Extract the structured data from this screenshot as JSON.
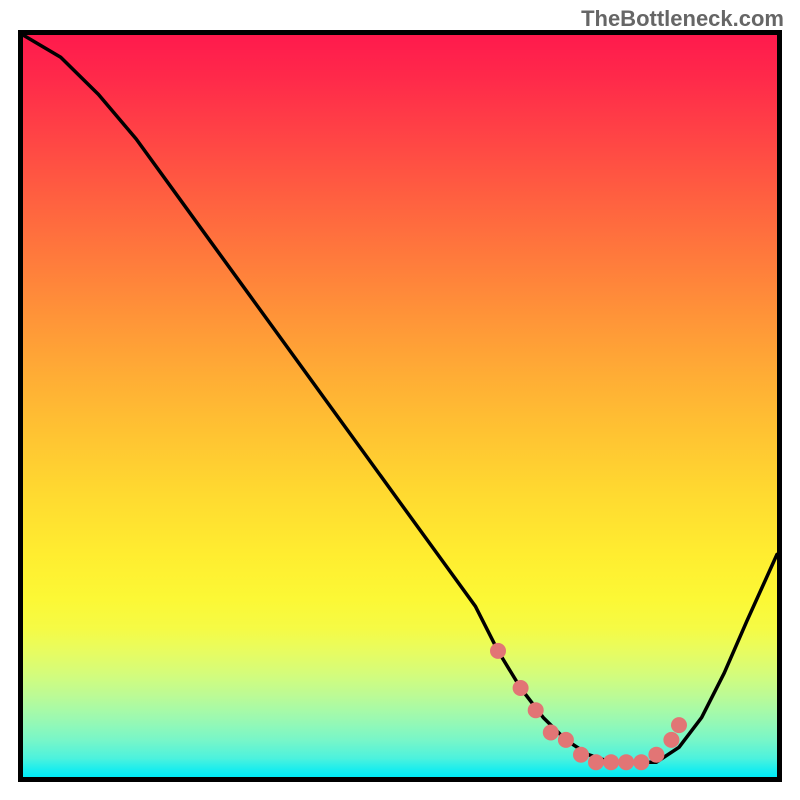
{
  "watermark": "TheBottleneck.com",
  "chart_data": {
    "type": "line",
    "title": "",
    "xlabel": "",
    "ylabel": "",
    "xlim": [
      0,
      100
    ],
    "ylim": [
      0,
      100
    ],
    "series": [
      {
        "name": "bottleneck-curve",
        "x": [
          0,
          5,
          10,
          15,
          20,
          25,
          30,
          35,
          40,
          45,
          50,
          55,
          60,
          63,
          66,
          69,
          72,
          75,
          78,
          81,
          84,
          87,
          90,
          93,
          96,
          100
        ],
        "y": [
          100,
          97,
          92,
          86,
          79,
          72,
          65,
          58,
          51,
          44,
          37,
          30,
          23,
          17,
          12,
          8,
          5,
          3,
          2,
          2,
          2,
          4,
          8,
          14,
          21,
          30
        ],
        "color": "#000000"
      }
    ],
    "markers": {
      "name": "optimal-range-dots",
      "x": [
        63,
        66,
        68,
        70,
        72,
        74,
        76,
        78,
        80,
        82,
        84,
        86,
        87
      ],
      "y": [
        17,
        12,
        9,
        6,
        5,
        3,
        2,
        2,
        2,
        2,
        3,
        5,
        7
      ],
      "color": "#e27575"
    }
  }
}
